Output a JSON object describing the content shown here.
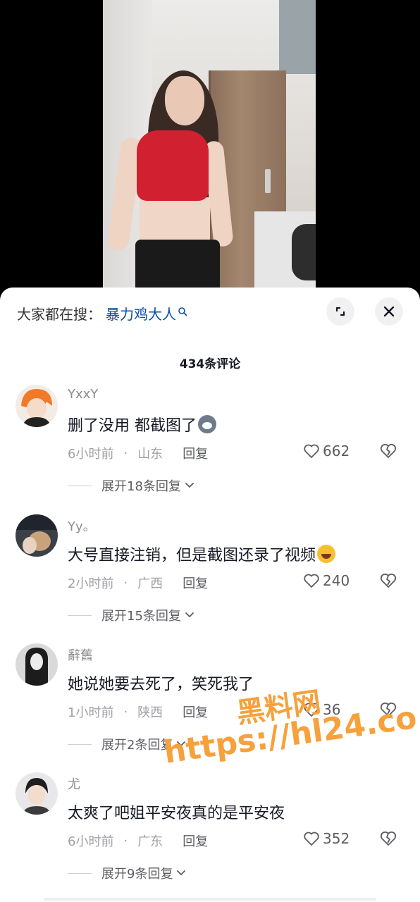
{
  "search": {
    "prefix": "大家都在搜：",
    "query": "暴力鸡大人"
  },
  "comment_count": "434条评论",
  "comments": [
    {
      "username": "YxxY",
      "text": "删了没用 都截图了",
      "emoji": "husky-emoji",
      "time": "6小时前",
      "location": "山东",
      "reply_label": "回复",
      "likes": "662",
      "expand_label": "展开18条回复"
    },
    {
      "username": "Yy。",
      "text": "大号直接注销，但是截图还录了视频",
      "emoji": "laugh-cry-emoji",
      "time": "2小时前",
      "location": "广西",
      "reply_label": "回复",
      "likes": "240",
      "expand_label": "展开15条回复"
    },
    {
      "username": "辭舊",
      "text": "她说她要去死了，笑死我了",
      "emoji": "",
      "time": "1小时前",
      "location": "陕西",
      "reply_label": "回复",
      "likes": "36",
      "expand_label": "展开2条回复"
    },
    {
      "username": "尤",
      "text": "太爽了吧姐平安夜真的是平安夜",
      "emoji": "",
      "time": "6小时前",
      "location": "广东",
      "reply_label": "回复",
      "likes": "352",
      "expand_label": "展开9条回复"
    }
  ],
  "meta_separator": "·",
  "watermark": {
    "line1": "黑料网",
    "line2": "https://hl24.co"
  },
  "colors": {
    "link_blue": "#0a4da0",
    "watermark_orange": "#f6a13c",
    "muted_text": "#a0a1a6"
  }
}
